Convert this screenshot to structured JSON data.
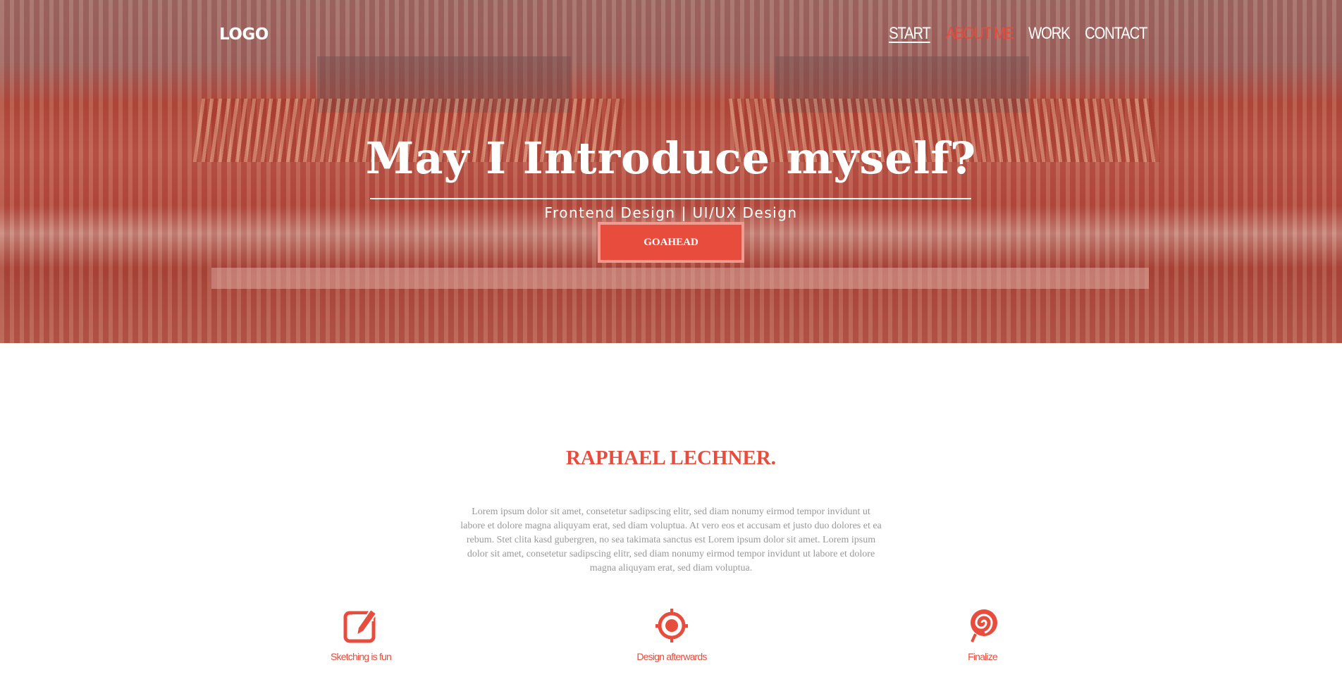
{
  "header": {
    "logo": "LOGO",
    "nav": [
      {
        "label": "START"
      },
      {
        "label": "ABOUT ME"
      },
      {
        "label": "WORK"
      },
      {
        "label": "CONTACT"
      }
    ]
  },
  "hero": {
    "title": "May I Introduce myself?",
    "subtitle": "Frontend Design | UI/UX Design",
    "button": "GOAHEAD"
  },
  "about": {
    "name": "RAPHAEL LECHNER.",
    "text": "Lorem ipsum dolor sit amet, consetetur sadipscing elitr, sed diam nonumy eirmod tempor invidunt ut labore et dolore magna aliquyam erat, sed diam voluptua. At vero eos et accusam et justo duo dolores et ea rebum. Stet clita kasd gubergren, no sea takimata sanctus est Lorem ipsum dolor sit amet. Lorem ipsum dolor sit amet, consetetur sadipscing elitr, sed diam nonumy eirmod tempor invidunt ut labore et dolore magna aliquyam erat, sed diam voluptua."
  },
  "features": [
    {
      "icon": "edit-icon",
      "label": "Sketching is fun"
    },
    {
      "icon": "target-icon",
      "label": "Design afterwards"
    },
    {
      "icon": "lollipop-icon",
      "label": "Finalize"
    }
  ],
  "colors": {
    "accent": "#e84c3d",
    "text_muted": "#999999"
  }
}
